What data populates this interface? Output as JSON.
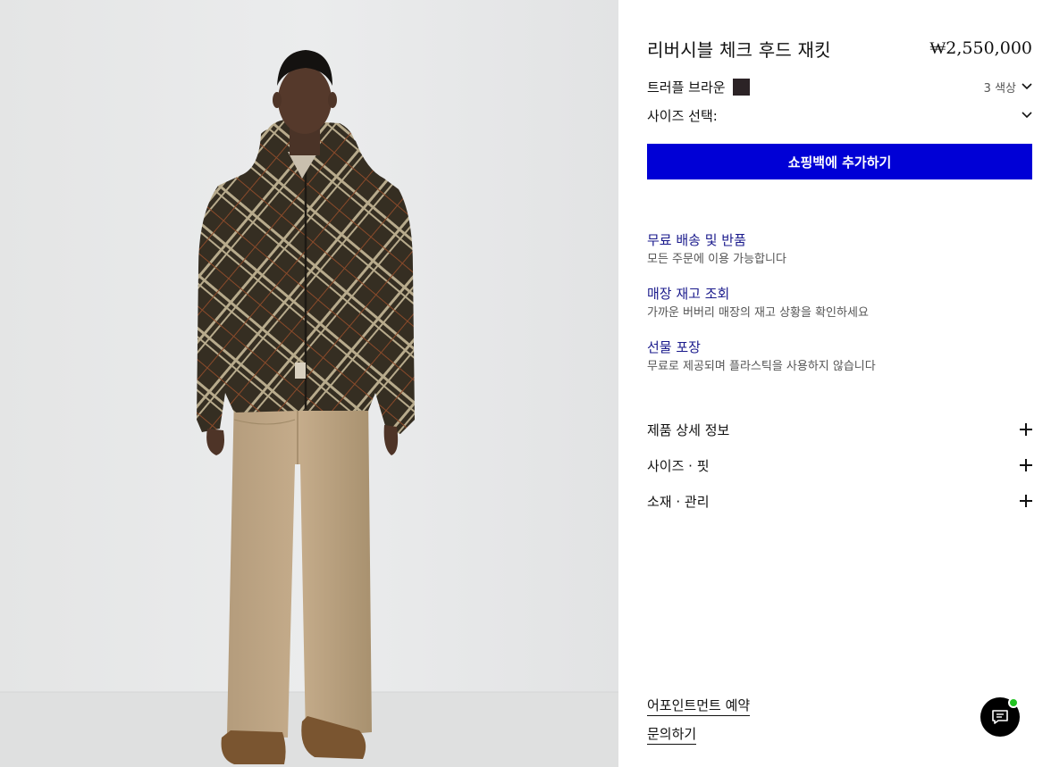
{
  "product": {
    "title": "리버시블 체크 후드 재킷",
    "price": "₩2,550,000",
    "color_name": "트러플 브라운",
    "color_swatch": "#2c2326",
    "color_count": "3 색상",
    "size_label": "사이즈 선택:",
    "add_to_bag": "쇼핑백에 추가하기",
    "accent_color": "#0000d6"
  },
  "services": [
    {
      "title": "무료 배송 및 반품",
      "desc": "모든 주문에 이용 가능합니다"
    },
    {
      "title": "매장 재고 조회",
      "desc": "가까운 버버리 매장의 재고 상황을 확인하세요"
    },
    {
      "title": "선물 포장",
      "desc": "무료로 제공되며 플라스틱을 사용하지 않습니다"
    }
  ],
  "accordion": [
    {
      "label": "제품 상세 정보",
      "icon": "plus-icon"
    },
    {
      "label": "사이즈 · 핏",
      "icon": "plus-icon"
    },
    {
      "label": "소재 · 관리",
      "icon": "plus-icon"
    }
  ],
  "links": {
    "appointment": "어포인트먼트 예약",
    "inquiry": "문의하기"
  },
  "chat": {
    "icon": "chat-icon",
    "status_color": "#22c322"
  }
}
